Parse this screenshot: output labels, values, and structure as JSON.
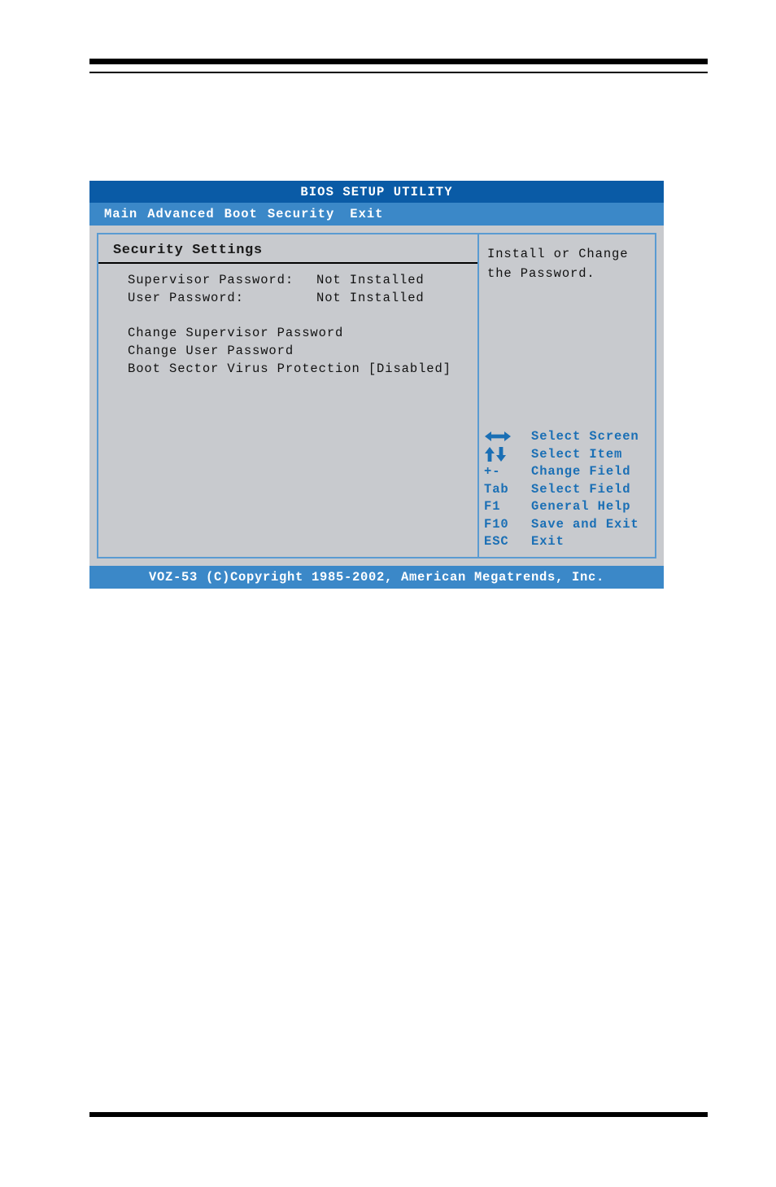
{
  "bios": {
    "title": "BIOS SETUP UTILITY",
    "menu": [
      {
        "label": "Main"
      },
      {
        "label": "Advanced"
      },
      {
        "label": "Boot"
      },
      {
        "label": "Security"
      },
      {
        "label": "Exit"
      }
    ],
    "section_title": "Security Settings",
    "settings": [
      {
        "label": "Supervisor Password:",
        "value": "Not Installed"
      },
      {
        "label": "User Password:",
        "value": "Not Installed"
      }
    ],
    "actions": [
      {
        "label": "Change Supervisor Password",
        "value": ""
      },
      {
        "label": "Change User Password",
        "value": ""
      },
      {
        "label": "Boot Sector Virus Protection",
        "value": "[Disabled]"
      }
    ],
    "help_line1": "Install or Change",
    "help_line2": "the Password.",
    "keys": [
      {
        "key": "left-right-arrow-icon",
        "is_icon": true,
        "desc": "Select Screen"
      },
      {
        "key": "up-down-arrow-icon",
        "is_icon": true,
        "desc": "Select Item"
      },
      {
        "key": "+-",
        "is_icon": false,
        "desc": "Change Field"
      },
      {
        "key": "Tab",
        "is_icon": false,
        "desc": "Select Field"
      },
      {
        "key": "F1",
        "is_icon": false,
        "desc": "General Help"
      },
      {
        "key": "F10",
        "is_icon": false,
        "desc": "Save and Exit"
      },
      {
        "key": "ESC",
        "is_icon": false,
        "desc": "Exit"
      }
    ],
    "footer": "VOZ-53 (C)Copyright 1985-2002, American Megatrends, Inc.",
    "colors": {
      "titlebar": "#0a5ba6",
      "menubar": "#3b88c8",
      "panel": "#c8cace",
      "border": "#5a9bd2",
      "key_text": "#1a6fb5"
    }
  }
}
